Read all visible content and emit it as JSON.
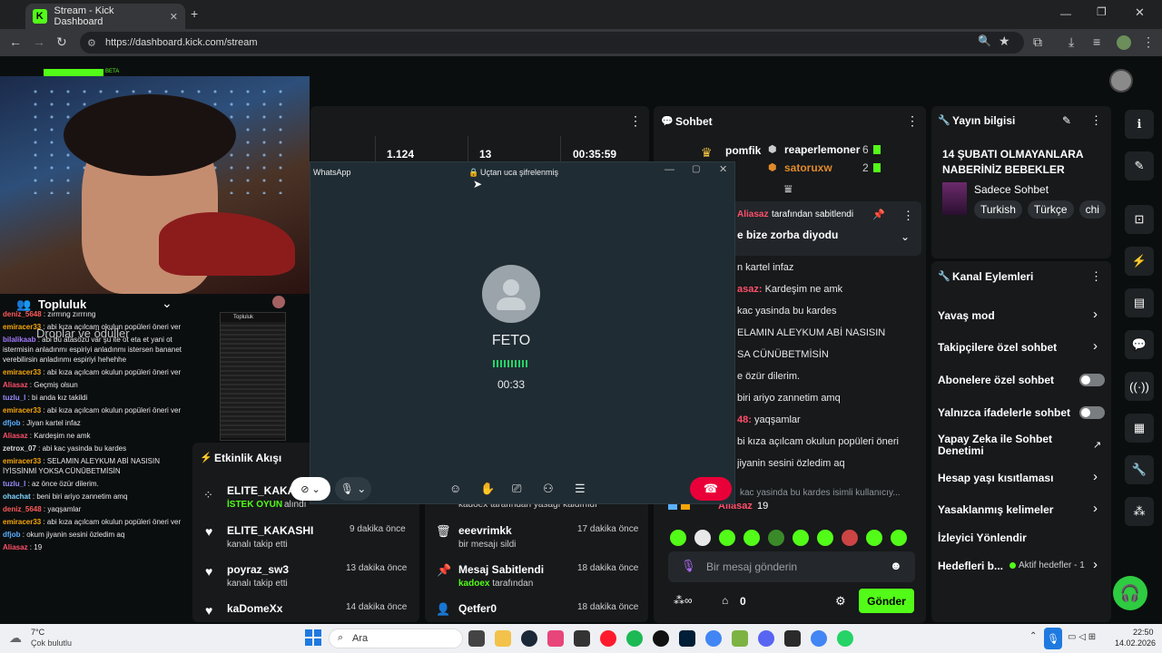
{
  "browser": {
    "tab_title": "Stream - Kick Dashboard",
    "url": "https://dashboard.kick.com/stream"
  },
  "stats": {
    "viewers": "1.124",
    "followers": "13",
    "uptime": "00:35:59"
  },
  "logo_badge": "BETA",
  "community": {
    "title": "Topluluk",
    "overlay": "Droplar ve ödüller",
    "mini_title": "Topluluk"
  },
  "community_chat": [
    {
      "user": "deniz_5648",
      "msg": "zırrrıng zırrrıng",
      "color": "#ff5a5a"
    },
    {
      "user": "emiracer33",
      "msg": "abi kıza açılcam okulun popüleri öneri ver",
      "color": "#f6a609"
    },
    {
      "user": "bilalikaab",
      "msg": "abi bu atasözü var şu ite ot eta et yani ot istermisin anladınmı espiriyi anladınmı istersen bananet verebilirsin anladınmı espiriyi hehehhe",
      "color": "#a57aff"
    },
    {
      "user": "emiracer33",
      "msg": "abi kıza açılcam okulun popüleri öneri ver",
      "color": "#f6a609"
    },
    {
      "user": "Aliasaz",
      "msg": "Geçmiş olsun",
      "color": "#ff4f6a"
    },
    {
      "user": "tuzlu_l",
      "msg": "bi anda kız takildi",
      "color": "#9b8cff"
    },
    {
      "user": "emiracer33",
      "msg": "abi kıza açılcam okulun popüleri öneri ver",
      "color": "#f6a609"
    },
    {
      "user": "dfjob",
      "msg": "Jiyan kartel infaz",
      "color": "#5ab0ff"
    },
    {
      "user": "Aliasaz",
      "msg": "Kardeşim ne amk",
      "color": "#ff4f6a"
    },
    {
      "user": "zetrox_07",
      "msg": "abi kac yasinda bu kardes",
      "color": "#dddddd"
    },
    {
      "user": "emiracer33",
      "msg": "SELAMIN ALEYKUM ABİ NASISIN İYİSSİNMİ YOKSA CÜNÜBETMİSİN",
      "color": "#f6a609"
    },
    {
      "user": "tuzlu_l",
      "msg": "az önce özür dilerim.",
      "color": "#9b8cff"
    },
    {
      "user": "ohachat",
      "msg": "beni biri ariyo zannetim amq",
      "color": "#7fd4ff"
    },
    {
      "user": "deniz_5648",
      "msg": "yaqşamlar",
      "color": "#ff5a5a"
    },
    {
      "user": "emiracer33",
      "msg": "abi kıza açılcam okulun popüleri öneri ver",
      "color": "#f6a609"
    },
    {
      "user": "dfjob",
      "msg": "okum jiyanin sesini özledim aq",
      "color": "#5ab0ff"
    },
    {
      "user": "Aliasaz",
      "msg": "19",
      "color": "#ff4f6a"
    }
  ],
  "activity": {
    "title": "Etkinlik Akışı",
    "left": [
      {
        "name": "ELITE_KAKA",
        "sub": "İSTEK OYUN",
        "extra": "alındı",
        "time": ""
      },
      {
        "name": "ELITE_KAKASHI",
        "sub": "kanalı takip etti",
        "time": "9 dakika önce"
      },
      {
        "name": "poyraz_sw3",
        "sub": "kanalı takip etti",
        "time": "13 dakika önce"
      },
      {
        "name": "kaDomeXx",
        "sub": "",
        "time": "14 dakika önce"
      }
    ],
    "right": [
      {
        "name": "",
        "sub": "kadoex tarafından yasağı kaldırıldı",
        "time": ""
      },
      {
        "name": "eeevrimkk",
        "sub": "bir mesajı sildi",
        "time": "17 dakika önce"
      },
      {
        "name": "Mesaj Sabitlendi",
        "sub_user": "kadoex",
        "sub": "tarafından",
        "time": "18 dakika önce"
      },
      {
        "name": "Qetfer0",
        "sub": "",
        "time": "18 dakika önce"
      }
    ]
  },
  "whatsapp": {
    "app": "WhatsApp",
    "encrypted": "Uçtan uca şifrelenmiş",
    "caller": "FETO",
    "duration": "00:33"
  },
  "chat": {
    "title": "Sohbet",
    "top": [
      {
        "user": "pomfik",
        "count": ""
      },
      {
        "user": "reaperlemoner",
        "count": "6"
      },
      {
        "user": "satoruxw",
        "count": "2"
      }
    ],
    "pinned_by": "Aliasaz",
    "pinned_label": "tarafından sabitlendi",
    "pinned_msg": "e bize zorba diyodu",
    "messages": [
      {
        "user": "",
        "msg": "n kartel infaz"
      },
      {
        "user": "asaz",
        "msg": "Kardeşim ne amk"
      },
      {
        "user": "",
        "msg": "kac yasinda bu kardes"
      },
      {
        "user": "",
        "msg": "ELAMIN ALEYKUM ABİ NASISIN"
      },
      {
        "user": "",
        "msg": "SA CÜNÜBETMİSİN"
      },
      {
        "user": "",
        "msg": "e özür dilerim."
      },
      {
        "user": "",
        "msg": "biri ariyo zannetim amq"
      },
      {
        "user": "48",
        "msg": "yaqşamlar"
      },
      {
        "user": "",
        "msg": "bi kıza açılcam okulun popüleri öneri"
      },
      {
        "user": "",
        "msg": "jiyanin sesini özledim aq"
      }
    ],
    "reply_preview": "kac yasinda bu kardes isimli kullanıcıy...",
    "last_user": "Aliasaz",
    "last_msg": "19",
    "input_placeholder": "Bir mesaj gönderin",
    "count": "0",
    "send_label": "Gönder"
  },
  "stream_info": {
    "title": "Yayın bilgisi",
    "stream_title": "14 ŞUBATI OLMAYANLARA NABERİNİZ BEBEKLER",
    "category": "Sadece Sohbet",
    "tags": [
      "Turkish",
      "Türkçe",
      "chi"
    ]
  },
  "channel_actions": {
    "title": "Kanal Eylemleri",
    "items": [
      {
        "label": "Yavaş mod",
        "kind": "chevron"
      },
      {
        "label": "Takipçilere özel sohbet",
        "kind": "chevron"
      },
      {
        "label": "Abonelere özel sohbet",
        "kind": "toggle"
      },
      {
        "label": "Yalnızca ifadelerle sohbet",
        "kind": "toggle"
      },
      {
        "label": "Yapay Zeka ile Sohbet Denetimi",
        "kind": "external"
      },
      {
        "label": "Hesap yaşı kısıtlaması",
        "kind": "chevron"
      },
      {
        "label": "Yasaklanmış kelimeler",
        "kind": "chevron"
      },
      {
        "label": "İzleyici Yönlendir",
        "kind": "none"
      },
      {
        "label": "Hedefleri b...",
        "kind": "chevron"
      }
    ],
    "goal_status": "Aktif hedefler - 1"
  },
  "taskbar": {
    "weather_temp": "7°C",
    "weather_desc": "Çok bulutlu",
    "search": "Ara",
    "time": "22:50",
    "date": "14.02.2026"
  }
}
